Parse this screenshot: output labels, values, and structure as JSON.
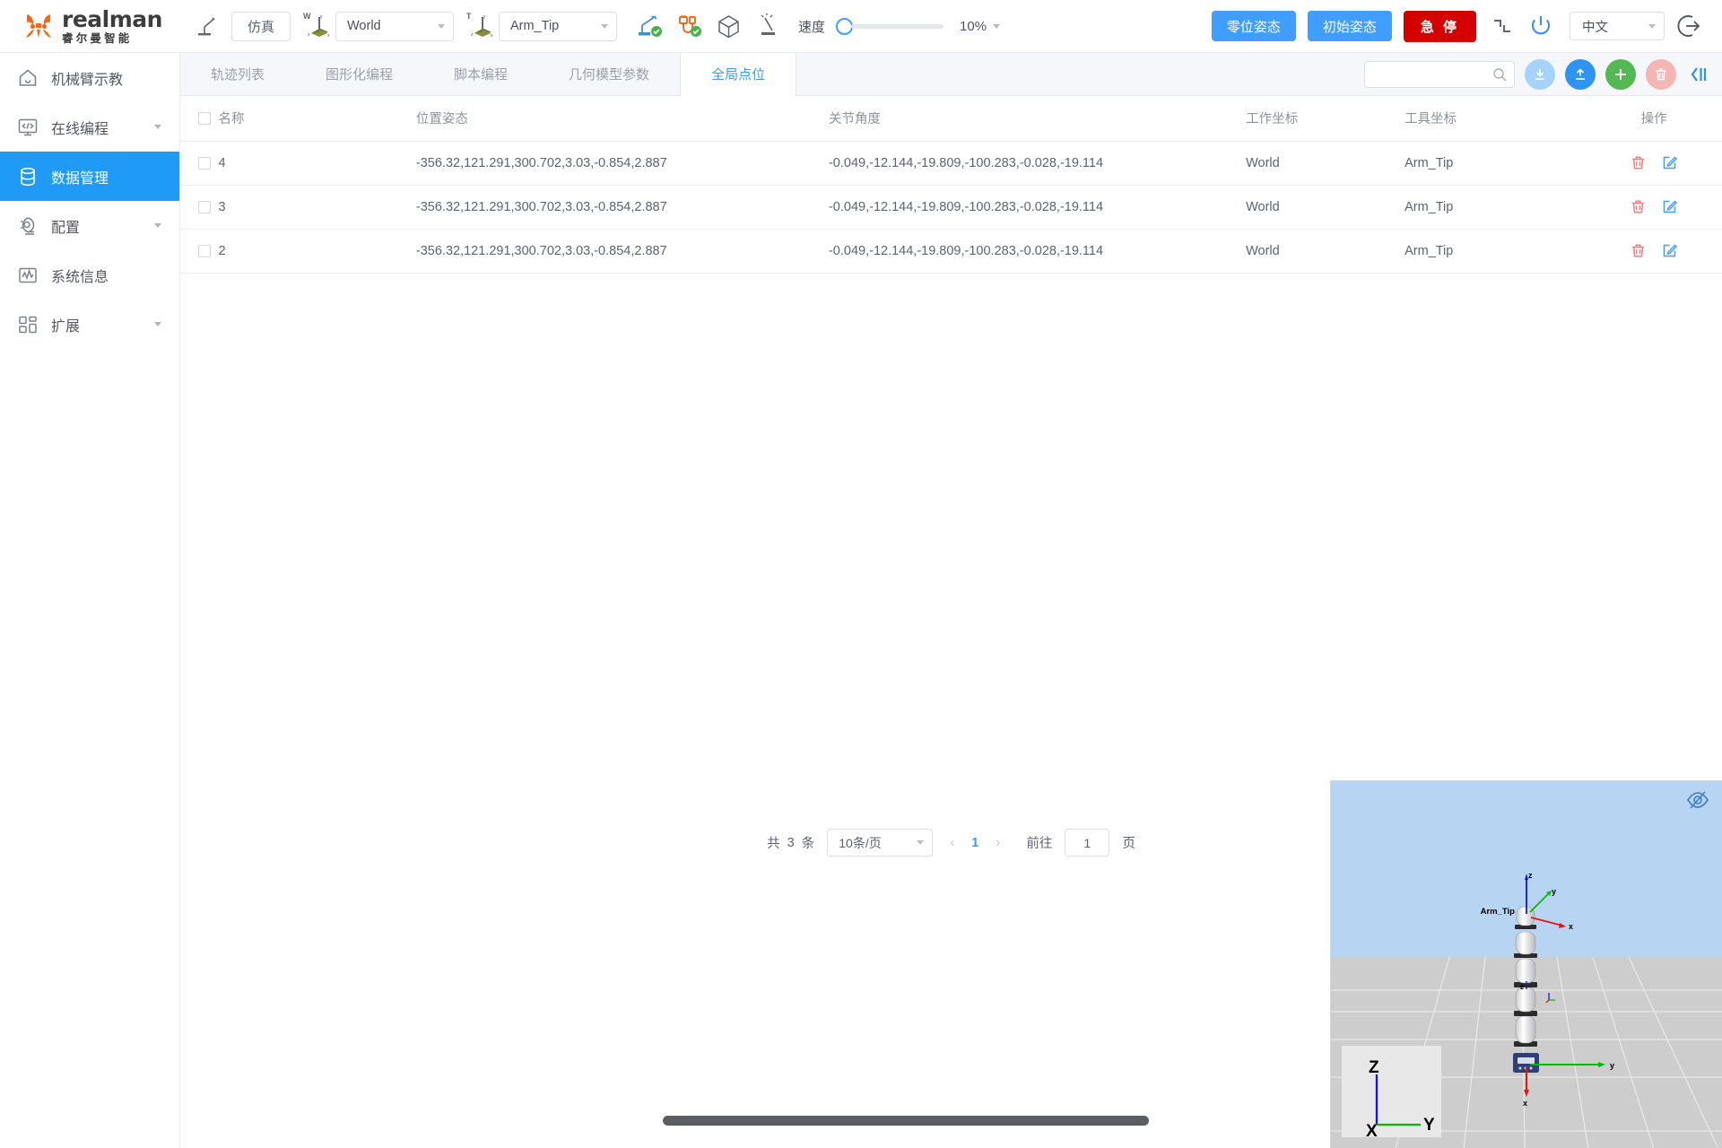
{
  "brand": {
    "name_en": "realman",
    "name_cn": "睿尔曼智能"
  },
  "toolbar": {
    "sim_button": "仿真",
    "world_frame": {
      "label": "World",
      "badge": "W"
    },
    "tool_frame": {
      "label": "Arm_Tip",
      "badge": "T"
    },
    "speed_label": "速度",
    "speed_value": "10%",
    "speed_percent": 10,
    "zero_pose_button": "零位姿态",
    "init_pose_button": "初始姿态",
    "estop_button": "急 停",
    "language": "中文",
    "icons": [
      "robot-connected-icon",
      "cable-connected-icon",
      "cube-icon",
      "robot-collision-icon",
      "joint-limit-icon",
      "power-icon",
      "logout-icon"
    ],
    "colors": {
      "primary": "#409eff",
      "danger": "#d40000",
      "success": "#53b952",
      "orange": "#ee6a1d"
    }
  },
  "sidebar": {
    "items": [
      {
        "label": "机械臂示教",
        "icon": "home-icon",
        "active": false,
        "expandable": false
      },
      {
        "label": "在线编程",
        "icon": "code-monitor-icon",
        "active": false,
        "expandable": true
      },
      {
        "label": "数据管理",
        "icon": "database-icon",
        "active": true,
        "expandable": false
      },
      {
        "label": "配置",
        "icon": "gear-icon",
        "active": false,
        "expandable": true
      },
      {
        "label": "系统信息",
        "icon": "waveform-icon",
        "active": false,
        "expandable": false
      },
      {
        "label": "扩展",
        "icon": "modules-icon",
        "active": false,
        "expandable": true
      }
    ]
  },
  "tabs": [
    {
      "label": "轨迹列表",
      "active": false
    },
    {
      "label": "图形化编程",
      "active": false
    },
    {
      "label": "脚本编程",
      "active": false
    },
    {
      "label": "几何模型参数",
      "active": false
    },
    {
      "label": "全局点位",
      "active": true
    }
  ],
  "tab_actions": {
    "search_placeholder": "",
    "search_value": "",
    "buttons": [
      {
        "name": "download-button",
        "icon": "download-icon"
      },
      {
        "name": "upload-button",
        "icon": "upload-icon"
      },
      {
        "name": "add-button",
        "icon": "plus-icon"
      },
      {
        "name": "delete-button",
        "icon": "trash-icon"
      },
      {
        "name": "collapse-panel-button",
        "icon": "collapse-left-icon"
      }
    ]
  },
  "table": {
    "columns": [
      "名称",
      "位置姿态",
      "关节角度",
      "工作坐标",
      "工具坐标",
      "操作"
    ],
    "rows": [
      {
        "name": "4",
        "pose": "-356.32,121.291,300.702,3.03,-0.854,2.887",
        "joints": "-0.049,-12.144,-19.809,-100.283,-0.028,-19.114",
        "work_frame": "World",
        "tool_frame": "Arm_Tip"
      },
      {
        "name": "3",
        "pose": "-356.32,121.291,300.702,3.03,-0.854,2.887",
        "joints": "-0.049,-12.144,-19.809,-100.283,-0.028,-19.114",
        "work_frame": "World",
        "tool_frame": "Arm_Tip"
      },
      {
        "name": "2",
        "pose": "-356.32,121.291,300.702,3.03,-0.854,2.887",
        "joints": "-0.049,-12.144,-19.809,-100.283,-0.028,-19.114",
        "work_frame": "World",
        "tool_frame": "Arm_Tip"
      }
    ]
  },
  "pagination": {
    "total_prefix": "共",
    "total_count": "3",
    "total_suffix": "条",
    "page_size": "10条/页",
    "current_page": "1",
    "goto_label": "前往",
    "goto_value": "1",
    "page_unit": "页"
  },
  "viewport": {
    "tcp_label": "Arm_Tip",
    "axes": {
      "x": "X",
      "y": "Y",
      "z": "Z"
    },
    "tcp_axes": {
      "x": "x",
      "y": "y",
      "z": "z"
    },
    "base_axes": {
      "x": "x",
      "y": "y"
    },
    "eye_icon": "eye-hidden-icon",
    "colors": {
      "sky": "#b7d5f2",
      "ground": "#cdcdcd",
      "x_axis": "#ee1111",
      "y_axis": "#00bb00",
      "z_axis": "#1111ee"
    }
  }
}
